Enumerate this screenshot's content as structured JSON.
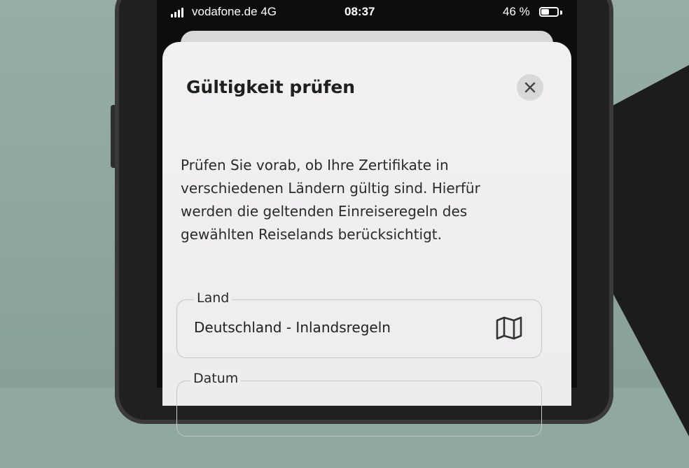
{
  "status_bar": {
    "carrier": "vodafone.de",
    "network": "4G",
    "time": "08:37",
    "battery": "46 %"
  },
  "dialog": {
    "title": "Gültigkeit prüfen",
    "close_icon": "close-icon",
    "description": "Prüfen Sie vorab, ob Ihre Zertifikate in verschiedenen Ländern gültig sind. Hierfür werden die geltenden Einreiseregeln des gewählten Reiselands berücksichtigt.",
    "country_field": {
      "label": "Land",
      "value": "Deutschland - Inlandsregeln",
      "icon": "map-icon"
    },
    "date_field": {
      "label": "Datum"
    }
  }
}
